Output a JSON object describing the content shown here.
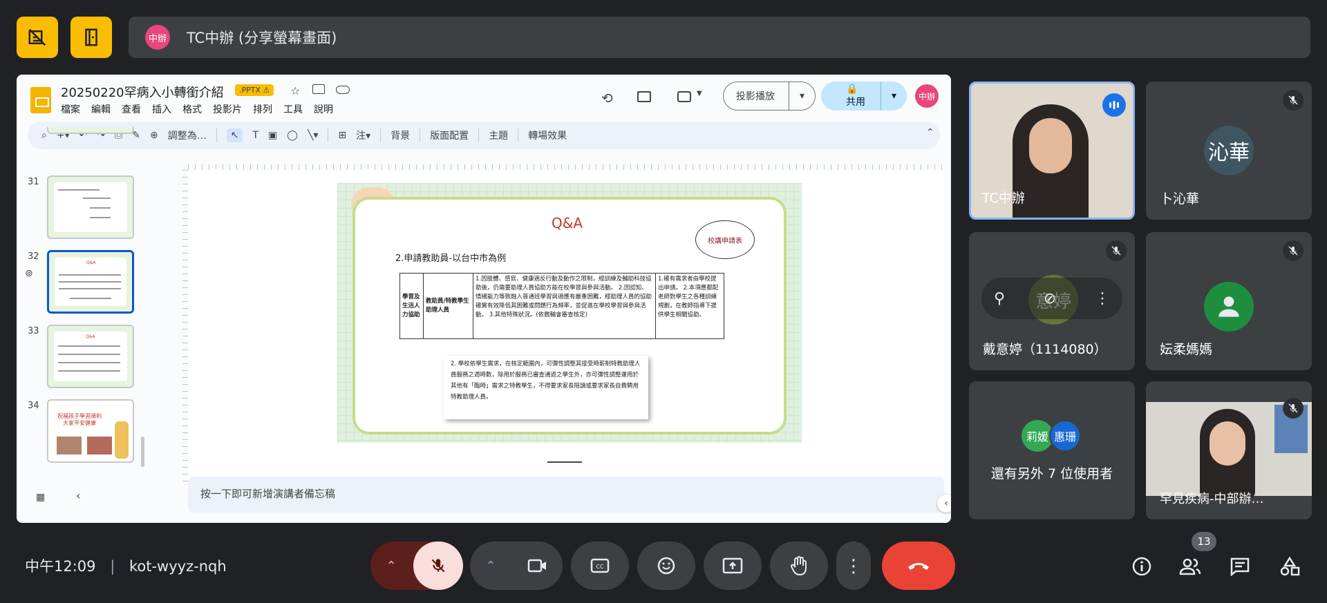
{
  "meeting": {
    "title_initial": "中辦",
    "share_title": "TC中辦 (分享螢幕畫面)",
    "time": "中午12:09",
    "code": "kot-wyyz-nqh",
    "participant_count": "13"
  },
  "slides_app": {
    "doc_title": "20250220罕病入小轉銜介紹",
    "file_badge": ".PPTX ⚠",
    "menu": [
      "檔案",
      "編輯",
      "查看",
      "插入",
      "格式",
      "投影片",
      "排列",
      "工具",
      "說明"
    ],
    "present_label": "投影播放",
    "share_label": "共用",
    "avatar": "中辦",
    "toolbar": {
      "zoom": "調整為…",
      "background": "背景",
      "layout": "版面配置",
      "theme": "主題",
      "transition": "轉場效果"
    },
    "thumbnails": [
      {
        "num": "31"
      },
      {
        "num": "32"
      },
      {
        "num": "33"
      },
      {
        "num": "34",
        "caption": "祝福孩子學習順利 大家平安健康"
      }
    ],
    "speaker_notes_placeholder": "按一下即可新增演講者備忘稿"
  },
  "slide": {
    "title": "Q&A",
    "bubble": "校講申請表",
    "subtitle": "2.申請教助員-以台中市為例",
    "table": {
      "col1": "學習及生活人力協助",
      "col2": "教助員/特教學生助理人員",
      "col3": "1.因肢體、感官、健康適反行動及動作之限制，經訓練及輔助科技協助後，仍需要助理人員協助方能在校學習與參與活動。 2.因認知、情緒能力等致融入普通班學習與適應有嚴重困難，經助理人員的協助確實有效降低其困難或問題行為頻率，並促進在學校學習與參與活動。 3.其他特殊狀況。(依鑑輔會審查核定)",
      "col4": "1.確有需求者由學校提出申請。 2.本項應都配老師對學生之各種訓練規劃，在教師指導下提供學生相關協助。"
    },
    "note": "2. 學校依學生需求，在核定範圍內，可彈性調整其接受時薪制特教助理人員服務之週時數，除用於服務已審查通過之學生外，亦可彈性調整運用於其他有「臨時」需求之特教學生，不得要求家長陪讀或要求家長自費聘用特教助理人員。"
  },
  "participants": [
    {
      "name": "TC中辦",
      "speaking": true
    },
    {
      "name": "卜沁華",
      "initials": "沁華",
      "muted": true
    },
    {
      "name": "戴意婷（1114080）",
      "initials": "意婷",
      "muted": true
    },
    {
      "name": "妘柔媽媽",
      "muted": true
    },
    {
      "name": "還有另外 7 位使用者",
      "avatars": [
        "莉媛",
        "惠珊"
      ]
    },
    {
      "name": "罕見疾病-中部辦…",
      "muted": true
    }
  ],
  "colors": {
    "accent_yellow": "#fbbc04",
    "end_call": "#ea4335",
    "speaking_border": "#8ab4f8",
    "mic_off_bg": "#f9dedc"
  }
}
